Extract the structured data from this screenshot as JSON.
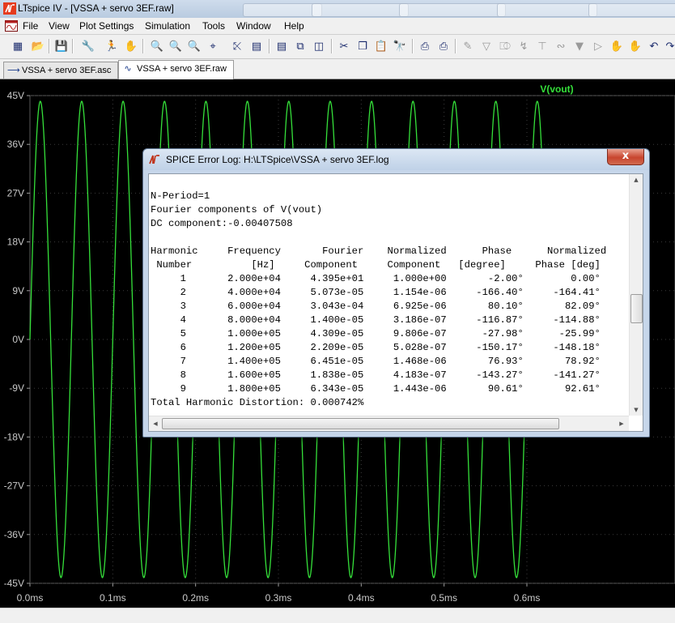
{
  "window": {
    "title": "LTspice IV - [VSSA + servo 3EF.raw]"
  },
  "menu": [
    "File",
    "View",
    "Plot Settings",
    "Simulation",
    "Tools",
    "Window",
    "Help"
  ],
  "toolbar_icons": [
    "new-schematic-icon",
    "open-icon",
    "save-icon",
    "control-panel-icon",
    "run-icon",
    "halt-icon",
    "zoom-in-icon",
    "zoom-pan-icon",
    "zoom-out-icon",
    "zoom-full-icon",
    "autorange-icon",
    "pick-visible-traces-icon",
    "tile-vertically-icon",
    "cascade-icon",
    "tile-horizontally-icon",
    "cut-icon",
    "copy-icon",
    "paste-icon",
    "find-icon",
    "print-setup-icon",
    "print-icon",
    "draw-wire-icon",
    "ground-icon",
    "label-net-icon",
    "resistor-icon",
    "capacitor-icon",
    "inductor-icon",
    "diode-icon",
    "component-icon",
    "move-icon",
    "drag-icon",
    "undo-icon",
    "redo-icon",
    "text-icon"
  ],
  "tabs": [
    {
      "label": "VSSA + servo 3EF.asc",
      "icon": "schematic-icon",
      "active": false
    },
    {
      "label": "VSSA + servo 3EF.raw",
      "icon": "waveform-icon",
      "active": true
    }
  ],
  "plot": {
    "trace_label": "V(vout)",
    "trace_color": "#35e03a",
    "background": "#000000",
    "y_ticks": [
      "45V",
      "36V",
      "27V",
      "18V",
      "9V",
      "0V",
      "-9V",
      "-18V",
      "-27V",
      "-36V",
      "-45V"
    ],
    "x_ticks": [
      "0.0ms",
      "0.1ms",
      "0.2ms",
      "0.3ms",
      "0.4ms",
      "0.5ms",
      "0.6ms"
    ]
  },
  "chart_data": {
    "type": "line",
    "title": "",
    "xlabel": "",
    "ylabel": "",
    "xlim": [
      0,
      0.6
    ],
    "x_unit": "ms",
    "ylim": [
      -45,
      45
    ],
    "y_unit": "V",
    "grid": "on",
    "series": [
      {
        "name": "V(vout)",
        "waveform": "sine",
        "amplitude": 43.95,
        "frequency_hz": 20000,
        "offset": 0
      }
    ]
  },
  "error_log": {
    "title": "SPICE Error Log: H:\\LTSpice\\VSSA + servo 3EF.log",
    "close_label": "x",
    "header_lines": [
      "N-Period=1",
      "Fourier components of V(vout)",
      "DC component:-0.00407508"
    ],
    "columns": [
      [
        "Harmonic",
        "Number"
      ],
      [
        "Frequency",
        "[Hz]"
      ],
      [
        "Fourier",
        "Component"
      ],
      [
        "Normalized",
        "Component"
      ],
      [
        "Phase",
        "[degree]"
      ],
      [
        "Normalized",
        "Phase [deg]"
      ]
    ],
    "rows": [
      [
        "1",
        "2.000e+04",
        "4.395e+01",
        "1.000e+00",
        "-2.00°",
        "0.00°"
      ],
      [
        "2",
        "4.000e+04",
        "5.073e-05",
        "1.154e-06",
        "-166.40°",
        "-164.41°"
      ],
      [
        "3",
        "6.000e+04",
        "3.043e-04",
        "6.925e-06",
        "80.10°",
        "82.09°"
      ],
      [
        "4",
        "8.000e+04",
        "1.400e-05",
        "3.186e-07",
        "-116.87°",
        "-114.88°"
      ],
      [
        "5",
        "1.000e+05",
        "4.309e-05",
        "9.806e-07",
        "-27.98°",
        "-25.99°"
      ],
      [
        "6",
        "1.200e+05",
        "2.209e-05",
        "5.028e-07",
        "-150.17°",
        "-148.18°"
      ],
      [
        "7",
        "1.400e+05",
        "6.451e-05",
        "1.468e-06",
        "76.93°",
        "78.92°"
      ],
      [
        "8",
        "1.600e+05",
        "1.838e-05",
        "4.183e-07",
        "-143.27°",
        "-141.27°"
      ],
      [
        "9",
        "1.800e+05",
        "6.343e-05",
        "1.443e-06",
        "90.61°",
        "92.61°"
      ]
    ],
    "footer": "Total Harmonic Distortion: 0.000742%"
  }
}
